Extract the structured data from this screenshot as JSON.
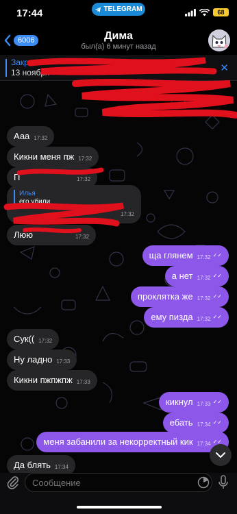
{
  "status_bar": {
    "time": "17:44",
    "telegram_pill": "TELEGRAM",
    "battery": "68"
  },
  "header": {
    "back_count": "6006",
    "title": "Дима",
    "subtitle": "был(а) 6 минут назад"
  },
  "pinned": {
    "title": "Закр",
    "text": "13 ноября"
  },
  "reply": {
    "name": "Илья",
    "text": "его убили"
  },
  "messages": {
    "m1": {
      "text": "Ааа",
      "time": "17:32"
    },
    "m2": {
      "text": "Кикни меня пж",
      "time": "17:32"
    },
    "m3": {
      "text": "П",
      "time": "17:32"
    },
    "m4": {
      "time": "17:32"
    },
    "m5": {
      "text": "Люю",
      "time": "17:32"
    },
    "m6": {
      "text": "ща глянем",
      "time": "17:32"
    },
    "m7": {
      "text": "а нет",
      "time": "17:32"
    },
    "m8": {
      "text": "проклятка же",
      "time": "17:32"
    },
    "m9": {
      "text": "ему пизда",
      "time": "17:32"
    },
    "m10": {
      "text": "Сук((",
      "time": "17:32"
    },
    "m11": {
      "text": "Ну ладно",
      "time": "17:33"
    },
    "m12": {
      "text": "Кикни пжпжпж",
      "time": "17:33"
    },
    "m13": {
      "text": "кикнул",
      "time": "17:33"
    },
    "m14": {
      "text": "ебать",
      "time": "17:34"
    },
    "m15": {
      "text": "меня забанили за некорректный кик",
      "time": "17:34"
    },
    "m16": {
      "text": "Да блять",
      "time": "17:34"
    }
  },
  "input": {
    "placeholder": "Сообщение"
  },
  "colors": {
    "accent": "#3d8bf5",
    "outgoing": "#8d57ea",
    "incoming": "#262628",
    "redaction": "#e0101c"
  }
}
